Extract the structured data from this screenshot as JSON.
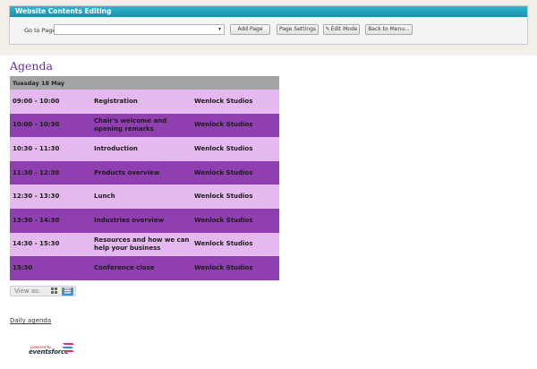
{
  "editor": {
    "title": "Website Contents Editing",
    "goto_label": "Go to Page",
    "page_select_value": "",
    "buttons": {
      "add_page": "Add Page",
      "page_settings": "Page Settings",
      "edit_mode": "Edit Mode",
      "back_to_menu": "Back to Menu..."
    }
  },
  "agenda": {
    "title": "Agenda",
    "day_header": "Tuesday 18 May",
    "rows": [
      {
        "time": "09:00 - 10:00",
        "session": "Registration",
        "venue": "Wenlock Studios"
      },
      {
        "time": "10:00 - 10:30",
        "session": "Chair's welcome and opening remarks",
        "venue": "Wenlock Studios"
      },
      {
        "time": "10:30 - 11:30",
        "session": "Introduction",
        "venue": "Wenlock Studios"
      },
      {
        "time": "11:30 - 12:30",
        "session": "Products overview",
        "venue": "Wenlock Studios"
      },
      {
        "time": "12:30 - 13:30",
        "session": "Lunch",
        "venue": "Wenlock Studios"
      },
      {
        "time": "13:30 - 14:30",
        "session": "Industries overview",
        "venue": "Wenlock Studios"
      },
      {
        "time": "14:30 - 15:30",
        "session": "Resources and how we can help your business",
        "venue": "Wenlock Studios"
      },
      {
        "time": "15:30",
        "session": "Conference close",
        "venue": "Wenlock Studios"
      }
    ]
  },
  "view_as": {
    "label": "View as:",
    "grid_icon": "grid-icon",
    "list_icon": "list-icon"
  },
  "daily_agenda_link": "Daily agenda",
  "footer": {
    "powered_by": "powered by",
    "brand": "eventsforce"
  },
  "colors": {
    "titlebar": "#1fa3bd",
    "row_light": "#e5b9ef",
    "row_dark": "#8f3fb0",
    "header_row": "#a3a3a3",
    "agenda_title": "#6a2aa6",
    "list_button": "#3b95d6"
  }
}
